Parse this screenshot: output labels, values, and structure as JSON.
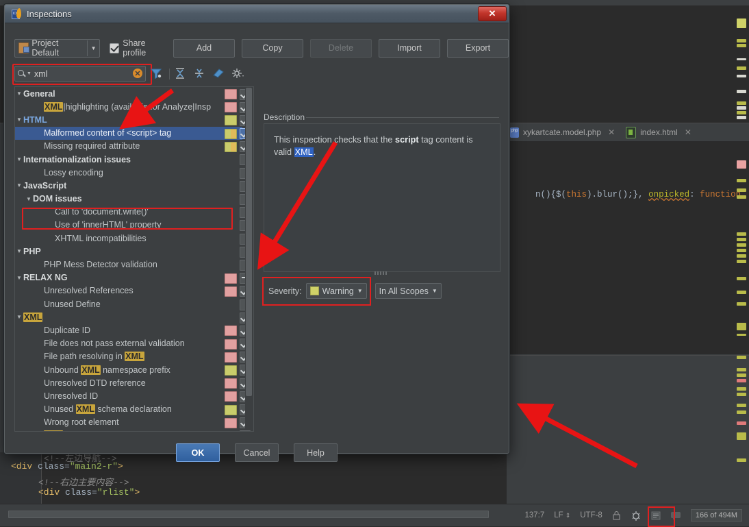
{
  "dialog": {
    "title": "Inspections",
    "close_label": "✕",
    "profile": {
      "value": "Project Default",
      "arrow": "▼",
      "icon": "profile-icon"
    },
    "share_profile": {
      "label": "Share profile",
      "checked": true
    },
    "buttons": [
      {
        "label": "Add",
        "enabled": true
      },
      {
        "label": "Copy",
        "enabled": true
      },
      {
        "label": "Delete",
        "enabled": false
      },
      {
        "label": "Import",
        "enabled": true
      },
      {
        "label": "Export",
        "enabled": true
      }
    ],
    "search": {
      "value": "xml",
      "placeholder": "",
      "clear_label": "✕",
      "magnifier": "search-icon"
    },
    "toolbar_icons": [
      "filter-icon",
      "expand-all-icon",
      "collapse-all-icon",
      "reset-icon",
      "settings-icon"
    ],
    "tree": [
      {
        "level": 0,
        "label": "General",
        "group": true,
        "expanded": true,
        "swatch": "red",
        "check": "on"
      },
      {
        "level": 2,
        "label": "XML|highlighting (available for Analyze|Insp",
        "hl": [
          "XML"
        ],
        "swatch": "red",
        "check": "on"
      },
      {
        "level": 0,
        "label": "HTML",
        "group": true,
        "blue": true,
        "expanded": true,
        "swatch": "yel",
        "check": "on"
      },
      {
        "level": 2,
        "label": "Malformed content of <script> tag",
        "selected": true,
        "swatch": "split",
        "check": "on"
      },
      {
        "level": 2,
        "label": "Missing required attribute",
        "swatch": "split",
        "check": "on"
      },
      {
        "level": 0,
        "label": "Internationalization issues",
        "group": true,
        "expanded": true,
        "swatch": "none",
        "check": "off"
      },
      {
        "level": 2,
        "label": "Lossy encoding",
        "swatch": "none",
        "check": "off"
      },
      {
        "level": 0,
        "label": "JavaScript",
        "group": true,
        "expanded": true,
        "swatch": "none",
        "check": "off"
      },
      {
        "level": 1,
        "label": "DOM issues",
        "group": true,
        "expanded": true,
        "swatch": "none",
        "check": "off"
      },
      {
        "level": 3,
        "label": "Call to 'document.write()'",
        "swatch": "none",
        "check": "off"
      },
      {
        "level": 3,
        "label": "Use of 'innerHTML' property",
        "swatch": "none",
        "check": "off"
      },
      {
        "level": 3,
        "label": "XHTML incompatibilities",
        "swatch": "none",
        "check": "off"
      },
      {
        "level": 0,
        "label": "PHP",
        "group": true,
        "expanded": true,
        "swatch": "none",
        "check": "off"
      },
      {
        "level": 2,
        "label": "PHP Mess Detector validation",
        "swatch": "none",
        "check": "off"
      },
      {
        "level": 0,
        "label": "RELAX NG",
        "group": true,
        "expanded": true,
        "swatch": "red",
        "check": "dash"
      },
      {
        "level": 2,
        "label": "Unresolved References",
        "swatch": "red",
        "check": "on"
      },
      {
        "level": 2,
        "label": "Unused Define",
        "swatch": "none",
        "check": "off"
      },
      {
        "level": 0,
        "label": "XML",
        "group": true,
        "hl": [
          "XML"
        ],
        "expanded": true,
        "swatch": "none",
        "check": "on"
      },
      {
        "level": 2,
        "label": "Duplicate ID",
        "swatch": "red",
        "check": "on"
      },
      {
        "level": 2,
        "label": "File does not pass external validation",
        "swatch": "red",
        "check": "on"
      },
      {
        "level": 2,
        "label": "File path resolving in XML",
        "hl": [
          "XML"
        ],
        "swatch": "red",
        "check": "on"
      },
      {
        "level": 2,
        "label": "Unbound XML namespace prefix",
        "hl": [
          "XML"
        ],
        "swatch": "yel",
        "check": "on"
      },
      {
        "level": 2,
        "label": "Unresolved DTD reference",
        "swatch": "red",
        "check": "on"
      },
      {
        "level": 2,
        "label": "Unresolved ID",
        "swatch": "red",
        "check": "on"
      },
      {
        "level": 2,
        "label": "Unused XML schema declaration",
        "hl": [
          "XML"
        ],
        "swatch": "yel",
        "check": "on"
      },
      {
        "level": 2,
        "label": "Wrong root element",
        "swatch": "red",
        "check": "on"
      },
      {
        "level": 2,
        "label": "XML tag empty body",
        "hl": [
          "XML"
        ],
        "swatch": "yel",
        "check": "on"
      }
    ],
    "description": {
      "label": "Description",
      "text_part1": "This inspection checks that the ",
      "bold": "script",
      "text_part2": " tag content is valid ",
      "selected_word": "XML",
      "text_part3": "."
    },
    "severity": {
      "label": "Severity:",
      "value": "Warning",
      "arrow": "▼",
      "scope": "In All Scopes",
      "scope_arrow": "▼"
    },
    "footer_buttons": [
      {
        "label": "OK",
        "primary": true
      },
      {
        "label": "Cancel",
        "primary": false
      },
      {
        "label": "Help",
        "primary": false
      }
    ]
  },
  "ide": {
    "tabs": [
      {
        "label": "xykartcate.model.php",
        "icon": "php-file-icon",
        "close": "✕"
      },
      {
        "label": "index.html",
        "icon": "html-file-icon",
        "close": "✕"
      }
    ],
    "code_snippet": "n(){$(this).blur();}, onpicked: function",
    "bottom_code": [
      "<div class=\"main2-r\">",
      "<!--右边主要内容-->",
      "<div class=\"rlist\">"
    ],
    "status_bar": {
      "caret": "137:7",
      "line_sep": "LF",
      "line_sep_arrows": "⇕",
      "encoding": "UTF-8",
      "lock_icon": "lock-icon",
      "inspection_icon": "inspection-profile-icon",
      "event_icon": "event-log-icon",
      "memory": "166 of 494M"
    }
  },
  "colors": {
    "dialog_bg": "#3c3f41",
    "selection_blue": "#3a5a92",
    "annotation_red": "#e02020",
    "highlight_yellow": "#c8a53c",
    "accent_blue": "#7aa7e0"
  }
}
